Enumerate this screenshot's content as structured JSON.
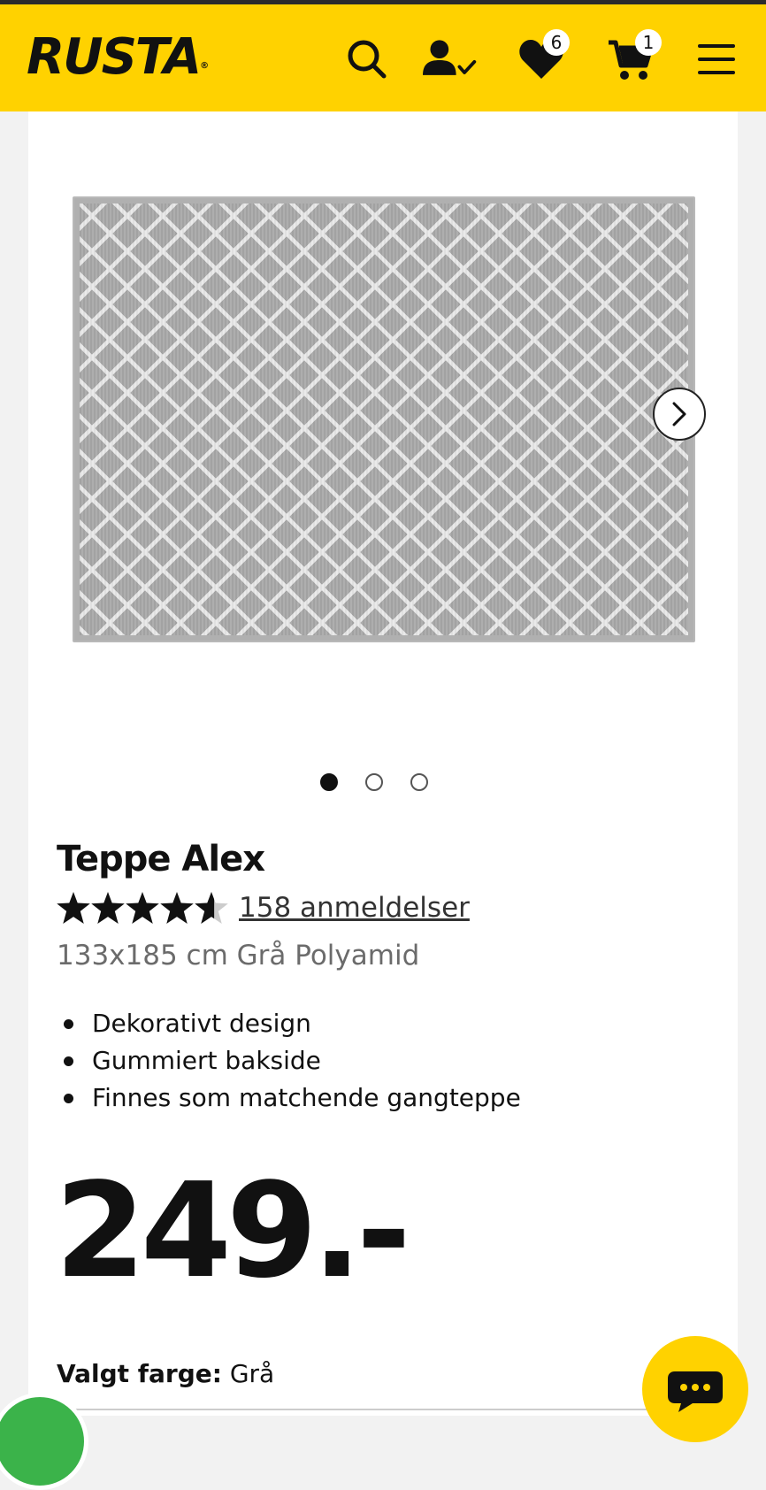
{
  "header": {
    "logo": "RUSTA",
    "logo_mark": "®",
    "icons": {
      "search": "search-icon",
      "account": "account-check-icon",
      "wishlist": "heart-icon",
      "cart": "cart-icon",
      "menu": "hamburger-menu-icon"
    },
    "wishlist_count": "6",
    "cart_count": "1",
    "background": "#ffd200"
  },
  "gallery": {
    "slides": 3,
    "active_slide": 1,
    "next_icon": "chevron-right-icon"
  },
  "product": {
    "title": "Teppe Alex",
    "rating": 4.5,
    "rating_max": 5,
    "reviews_label": "158 anmeldelser",
    "subtitle": "133x185 cm Grå Polyamid",
    "features": [
      "Dekorativt design",
      "Gummiert bakside",
      "Finnes som matchende gangteppe"
    ],
    "price": "249.-",
    "chosen_color_label": "Valgt farge:",
    "chosen_color_value": "Grå"
  },
  "floating": {
    "chat_icon": "chat-bubble-icon",
    "chat_color": "#ffd200"
  }
}
